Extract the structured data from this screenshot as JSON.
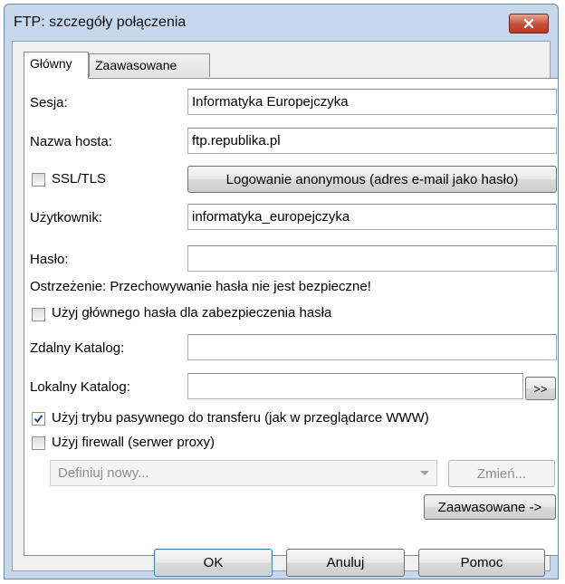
{
  "window": {
    "title": "FTP: szczegóły połączenia"
  },
  "tabs": [
    {
      "label": "Główny"
    },
    {
      "label": "Zaawasowane"
    }
  ],
  "fields": {
    "session_label": "Sesja:",
    "session_value": "Informatyka Europejczyka",
    "host_label": "Nazwa hosta:",
    "host_value": "ftp.republika.pl",
    "ssl_label": "SSL/TLS",
    "anonymous_button": "Logowanie anonymous (adres e-mail jako hasło)",
    "user_label": "Użytkownik:",
    "user_value": "informatyka_europejczyka",
    "password_label": "Hasło:",
    "password_value": "",
    "warning": "Ostrzeżenie: Przechowywanie hasła nie jest bezpieczne!",
    "master_password_label": "Użyj głównego hasła dla zabezpieczenia hasła",
    "remote_dir_label": "Zdalny Katalog:",
    "remote_dir_value": "",
    "local_dir_label": "Lokalny Katalog:",
    "local_dir_value": "",
    "browse_button": ">>",
    "passive_label": "Użyj trybu pasywnego do transferu (jak w przeglądarce WWW)",
    "passive_checked": true,
    "firewall_label": "Użyj firewall (serwer proxy)",
    "firewall_checked": false,
    "proxy_select": "Definiuj nowy...",
    "change_button": "Zmień...",
    "advanced_button": "Zaawasowane ->"
  },
  "buttons": {
    "ok": "OK",
    "cancel": "Anuluj",
    "help": "Pomoc"
  },
  "icons": {
    "close": "close-icon",
    "check": "checkmark-icon",
    "dropdown": "chevron-down-icon"
  },
  "colors": {
    "titlebar": "#c7d8ec",
    "close_button": "#c9553d",
    "check_mark": "#1f3f8f"
  }
}
